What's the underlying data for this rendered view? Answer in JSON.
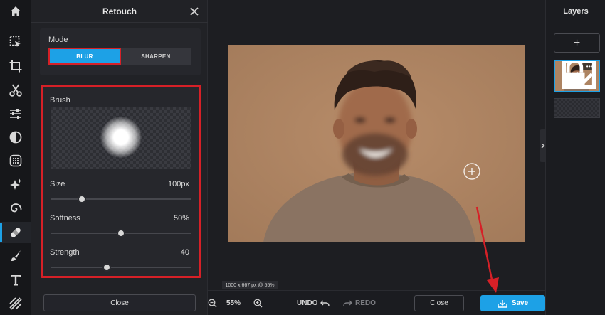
{
  "panel": {
    "title": "Retouch",
    "mode_label": "Mode",
    "modes": [
      {
        "label": "BLUR",
        "selected": true
      },
      {
        "label": "SHARPEN",
        "selected": false
      }
    ],
    "brush_label": "Brush",
    "sliders": [
      {
        "label": "Size",
        "value": "100px",
        "fraction": 0.22
      },
      {
        "label": "Softness",
        "value": "50%",
        "fraction": 0.5
      },
      {
        "label": "Strength",
        "value": "40",
        "fraction": 0.4
      }
    ],
    "close_label": "Close"
  },
  "tools": [
    {
      "name": "home-icon"
    },
    {
      "name": "select-arrow-icon"
    },
    {
      "name": "crop-icon"
    },
    {
      "name": "scissors-icon"
    },
    {
      "name": "adjust-sliders-icon"
    },
    {
      "name": "contrast-icon"
    },
    {
      "name": "texture-grid-icon"
    },
    {
      "name": "sparkle-effects-icon"
    },
    {
      "name": "spiral-liquify-icon"
    },
    {
      "name": "bandage-retouch-icon",
      "active": true
    },
    {
      "name": "brush-draw-icon"
    },
    {
      "name": "text-icon"
    },
    {
      "name": "hatch-pattern-icon"
    }
  ],
  "canvas": {
    "dimensions_label": "1000 x 667 px @ 55%"
  },
  "bottombar": {
    "zoom_value": "55%",
    "undo_label": "UNDO",
    "redo_label": "REDO",
    "close_label": "Close",
    "save_label": "Save"
  },
  "layers": {
    "title": "Layers",
    "add_label": "+",
    "more_label": "•••"
  },
  "colors": {
    "accent": "#1da1e6",
    "annotation": "#d62027",
    "panel_bg": "#212226",
    "photo_bg": "#ad8462"
  }
}
